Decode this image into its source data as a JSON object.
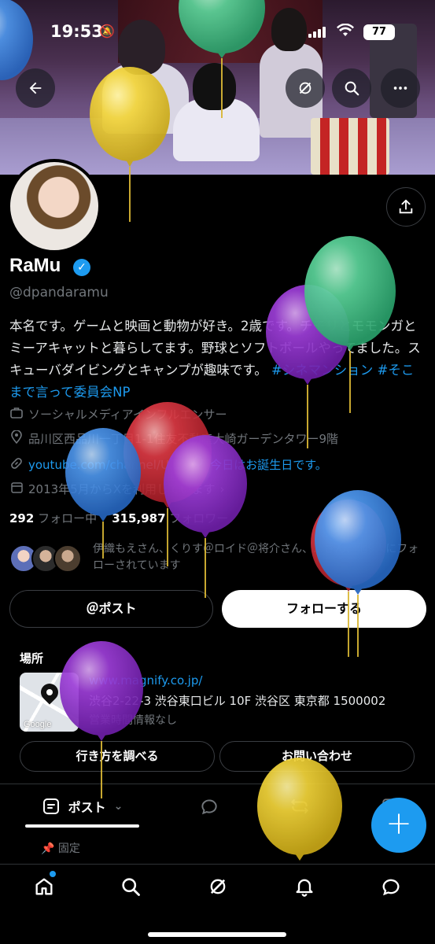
{
  "status_bar": {
    "time": "19:53",
    "battery": "77"
  },
  "profile": {
    "name": "RaMu",
    "handle": "@dpandaramu",
    "bio_plain": "本名です。ゲームと映画と動物が好き。2歳です。チモリとモモンガとミーアキャットと暮らしてます。野球とソフトボールやってました。スキューバダイビングとキャンプが趣味です。",
    "bio_tags": "#シネマンション #そこまで言って委員会NP",
    "category": "ソーシャルメディアインフルエンサー",
    "location": "品川区西品川一丁目1-1住友不動産大崎ガーデンタワー9階",
    "website": "youtube.com/channel/U...",
    "birthday": "今日はお誕生日です。",
    "joined": "2013年5月からXを利用しています",
    "following_count": "292",
    "following_label": "フォロー中",
    "followers_count": "315,987",
    "followers_label": "フォロワー",
    "followed_by": "伊織もえさん、くりす＠ロイド＠将介さん、...さん、他9人にフォローされています"
  },
  "buttons": {
    "mention": "＠ポスト",
    "follow": "フォローする",
    "directions": "行き方を調べる",
    "contact": "お問い合わせ"
  },
  "location_card": {
    "title": "場所",
    "url": "www.magnify.co.jp/",
    "address": "渋谷2-22-3 渋谷東口ビル 10F 渋谷区 東京都 1500002",
    "hours": "営業時間情報なし",
    "map_label": "Google"
  },
  "tabs": {
    "posts": "ポスト"
  },
  "pinned_label": "固定",
  "colors": {
    "accent": "#1d9bf0",
    "background": "#000000",
    "muted": "#71767b"
  },
  "icons": [
    "back-arrow-icon",
    "grok-icon",
    "search-icon",
    "more-icon",
    "share-icon",
    "verified-icon",
    "briefcase-icon",
    "location-pin-icon",
    "link-icon",
    "balloon-icon",
    "calendar-icon",
    "home-icon",
    "bell-icon",
    "messages-icon",
    "plus-icon"
  ]
}
